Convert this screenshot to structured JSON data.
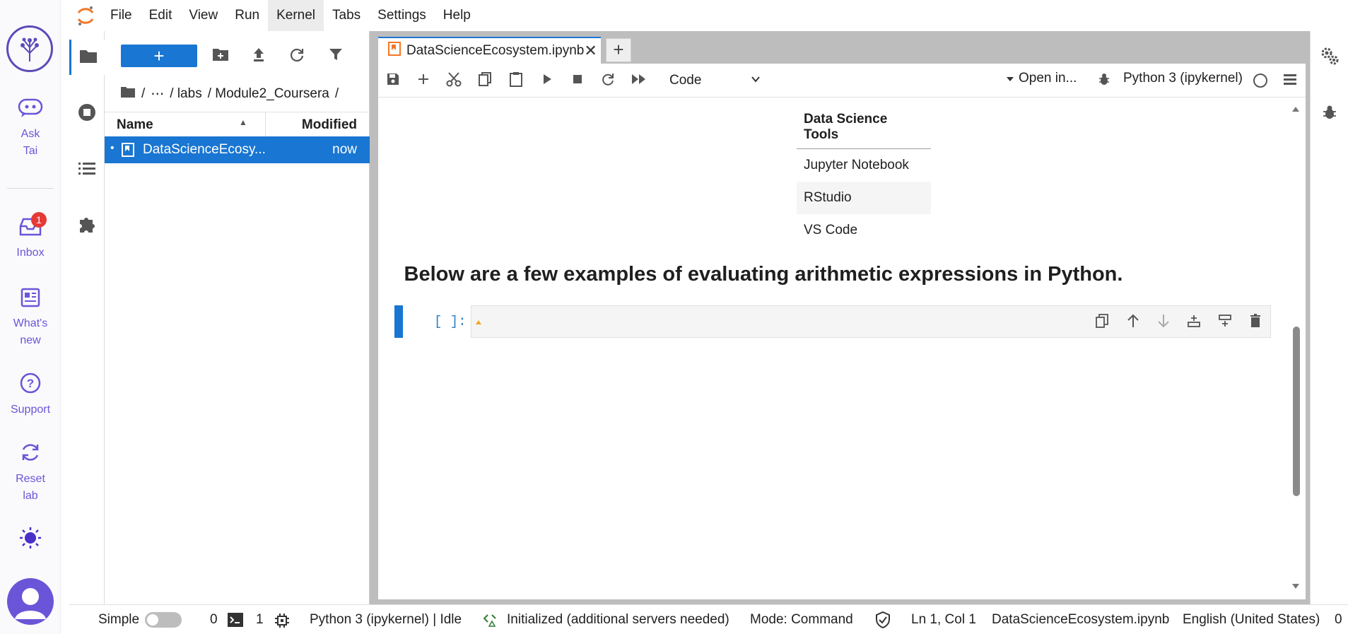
{
  "outer_rail": {
    "ask_tai": "Ask\nTai",
    "ask_tai_l1": "Ask",
    "ask_tai_l2": "Tai",
    "inbox": "Inbox",
    "inbox_badge": "1",
    "whats_new_l1": "What's",
    "whats_new_l2": "new",
    "support": "Support",
    "reset_l1": "Reset",
    "reset_l2": "lab"
  },
  "menubar": {
    "items": [
      "File",
      "Edit",
      "View",
      "Run",
      "Kernel",
      "Tabs",
      "Settings",
      "Help"
    ],
    "active": "Kernel"
  },
  "filebrowser": {
    "new_label": "+",
    "breadcrumb": [
      "/",
      "⋯",
      "/ labs",
      "/ Module2_Coursera",
      "/"
    ],
    "col_name": "Name",
    "col_modified": "Modified",
    "files": [
      {
        "name": "DataScienceEcosy...",
        "modified": "now",
        "selected": true
      }
    ]
  },
  "tabs": [
    {
      "label": "DataScienceEcosystem.ipynb",
      "active": true
    }
  ],
  "tab_add": "+",
  "notebook_toolbar": {
    "cell_type": "Code",
    "open_in": "Open in...",
    "kernel": "Python 3 (ipykernel)"
  },
  "notebook": {
    "table_header": "Data Science Tools",
    "table_rows": [
      "Jupyter Notebook",
      "RStudio",
      "VS Code"
    ],
    "heading": "Below are a few examples of evaluating arithmetic expressions in Python.",
    "code_prompt": "[ ]:"
  },
  "statusbar": {
    "mode_simple": "Simple",
    "count_terminals": "0",
    "count_kernels": "1",
    "kernel_status": "Python 3 (ipykernel) | Idle",
    "lsp": "Initialized (additional servers needed)",
    "mode": "Mode: Command",
    "cursor": "Ln 1, Col 1",
    "file": "DataScienceEcosystem.ipynb",
    "language": "English (United States)",
    "trailing": "0"
  },
  "colors": {
    "accent": "#1976d2",
    "rail_purple": "#6a55d8",
    "jupyter_orange": "#f37726"
  }
}
